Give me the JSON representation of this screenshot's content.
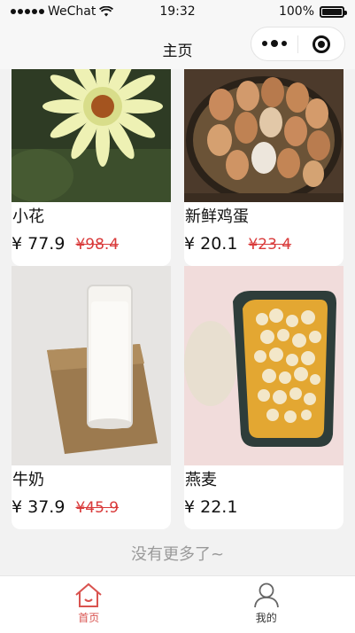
{
  "status_bar": {
    "carrier": "WeChat",
    "time": "19:32",
    "battery": "100%"
  },
  "nav": {
    "title": "主页"
  },
  "products": [
    {
      "name": "小花",
      "price": "¥ 77.9",
      "original_price": "¥98.4"
    },
    {
      "name": "新鲜鸡蛋",
      "price": "¥ 20.1",
      "original_price": "¥23.4"
    },
    {
      "name": "牛奶",
      "price": "¥ 37.9",
      "original_price": "¥45.9"
    },
    {
      "name": "燕麦",
      "price": "¥ 22.1",
      "original_price": ""
    }
  ],
  "footer_note": "没有更多了~",
  "tabbar": {
    "items": [
      {
        "label": "首页",
        "icon": "home-icon",
        "active": true
      },
      {
        "label": "我的",
        "icon": "user-icon",
        "active": false
      }
    ]
  },
  "colors": {
    "accent": "#d9534f",
    "background": "#f2f2f2"
  }
}
